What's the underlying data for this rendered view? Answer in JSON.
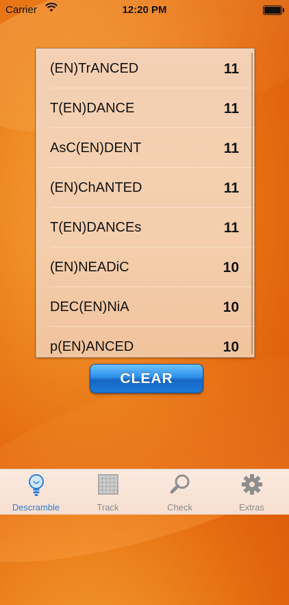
{
  "status_bar": {
    "carrier": "Carrier",
    "time": "12:20 PM"
  },
  "results": [
    {
      "word": "(EN)TrANCED",
      "score": "11"
    },
    {
      "word": "T(EN)DANCE",
      "score": "11"
    },
    {
      "word": "AsC(EN)DENT",
      "score": "11"
    },
    {
      "word": "(EN)ChANTED",
      "score": "11"
    },
    {
      "word": "T(EN)DANCEs",
      "score": "11"
    },
    {
      "word": "(EN)NEADiC",
      "score": "10"
    },
    {
      "word": "DEC(EN)NiA",
      "score": "10"
    },
    {
      "word": "p(EN)ANCED",
      "score": "10"
    }
  ],
  "clear_button": {
    "label": "CLEAR"
  },
  "tabs": [
    {
      "label": "Descramble",
      "icon": "lightbulb-icon",
      "active": true
    },
    {
      "label": "Track",
      "icon": "grid-icon",
      "active": false
    },
    {
      "label": "Check",
      "icon": "magnifier-icon",
      "active": false
    },
    {
      "label": "Extras",
      "icon": "gear-icon",
      "active": false
    }
  ],
  "colors": {
    "background": "#e56a10",
    "accent_blue": "#2f7fd1",
    "button_blue": "#1e78d8"
  }
}
